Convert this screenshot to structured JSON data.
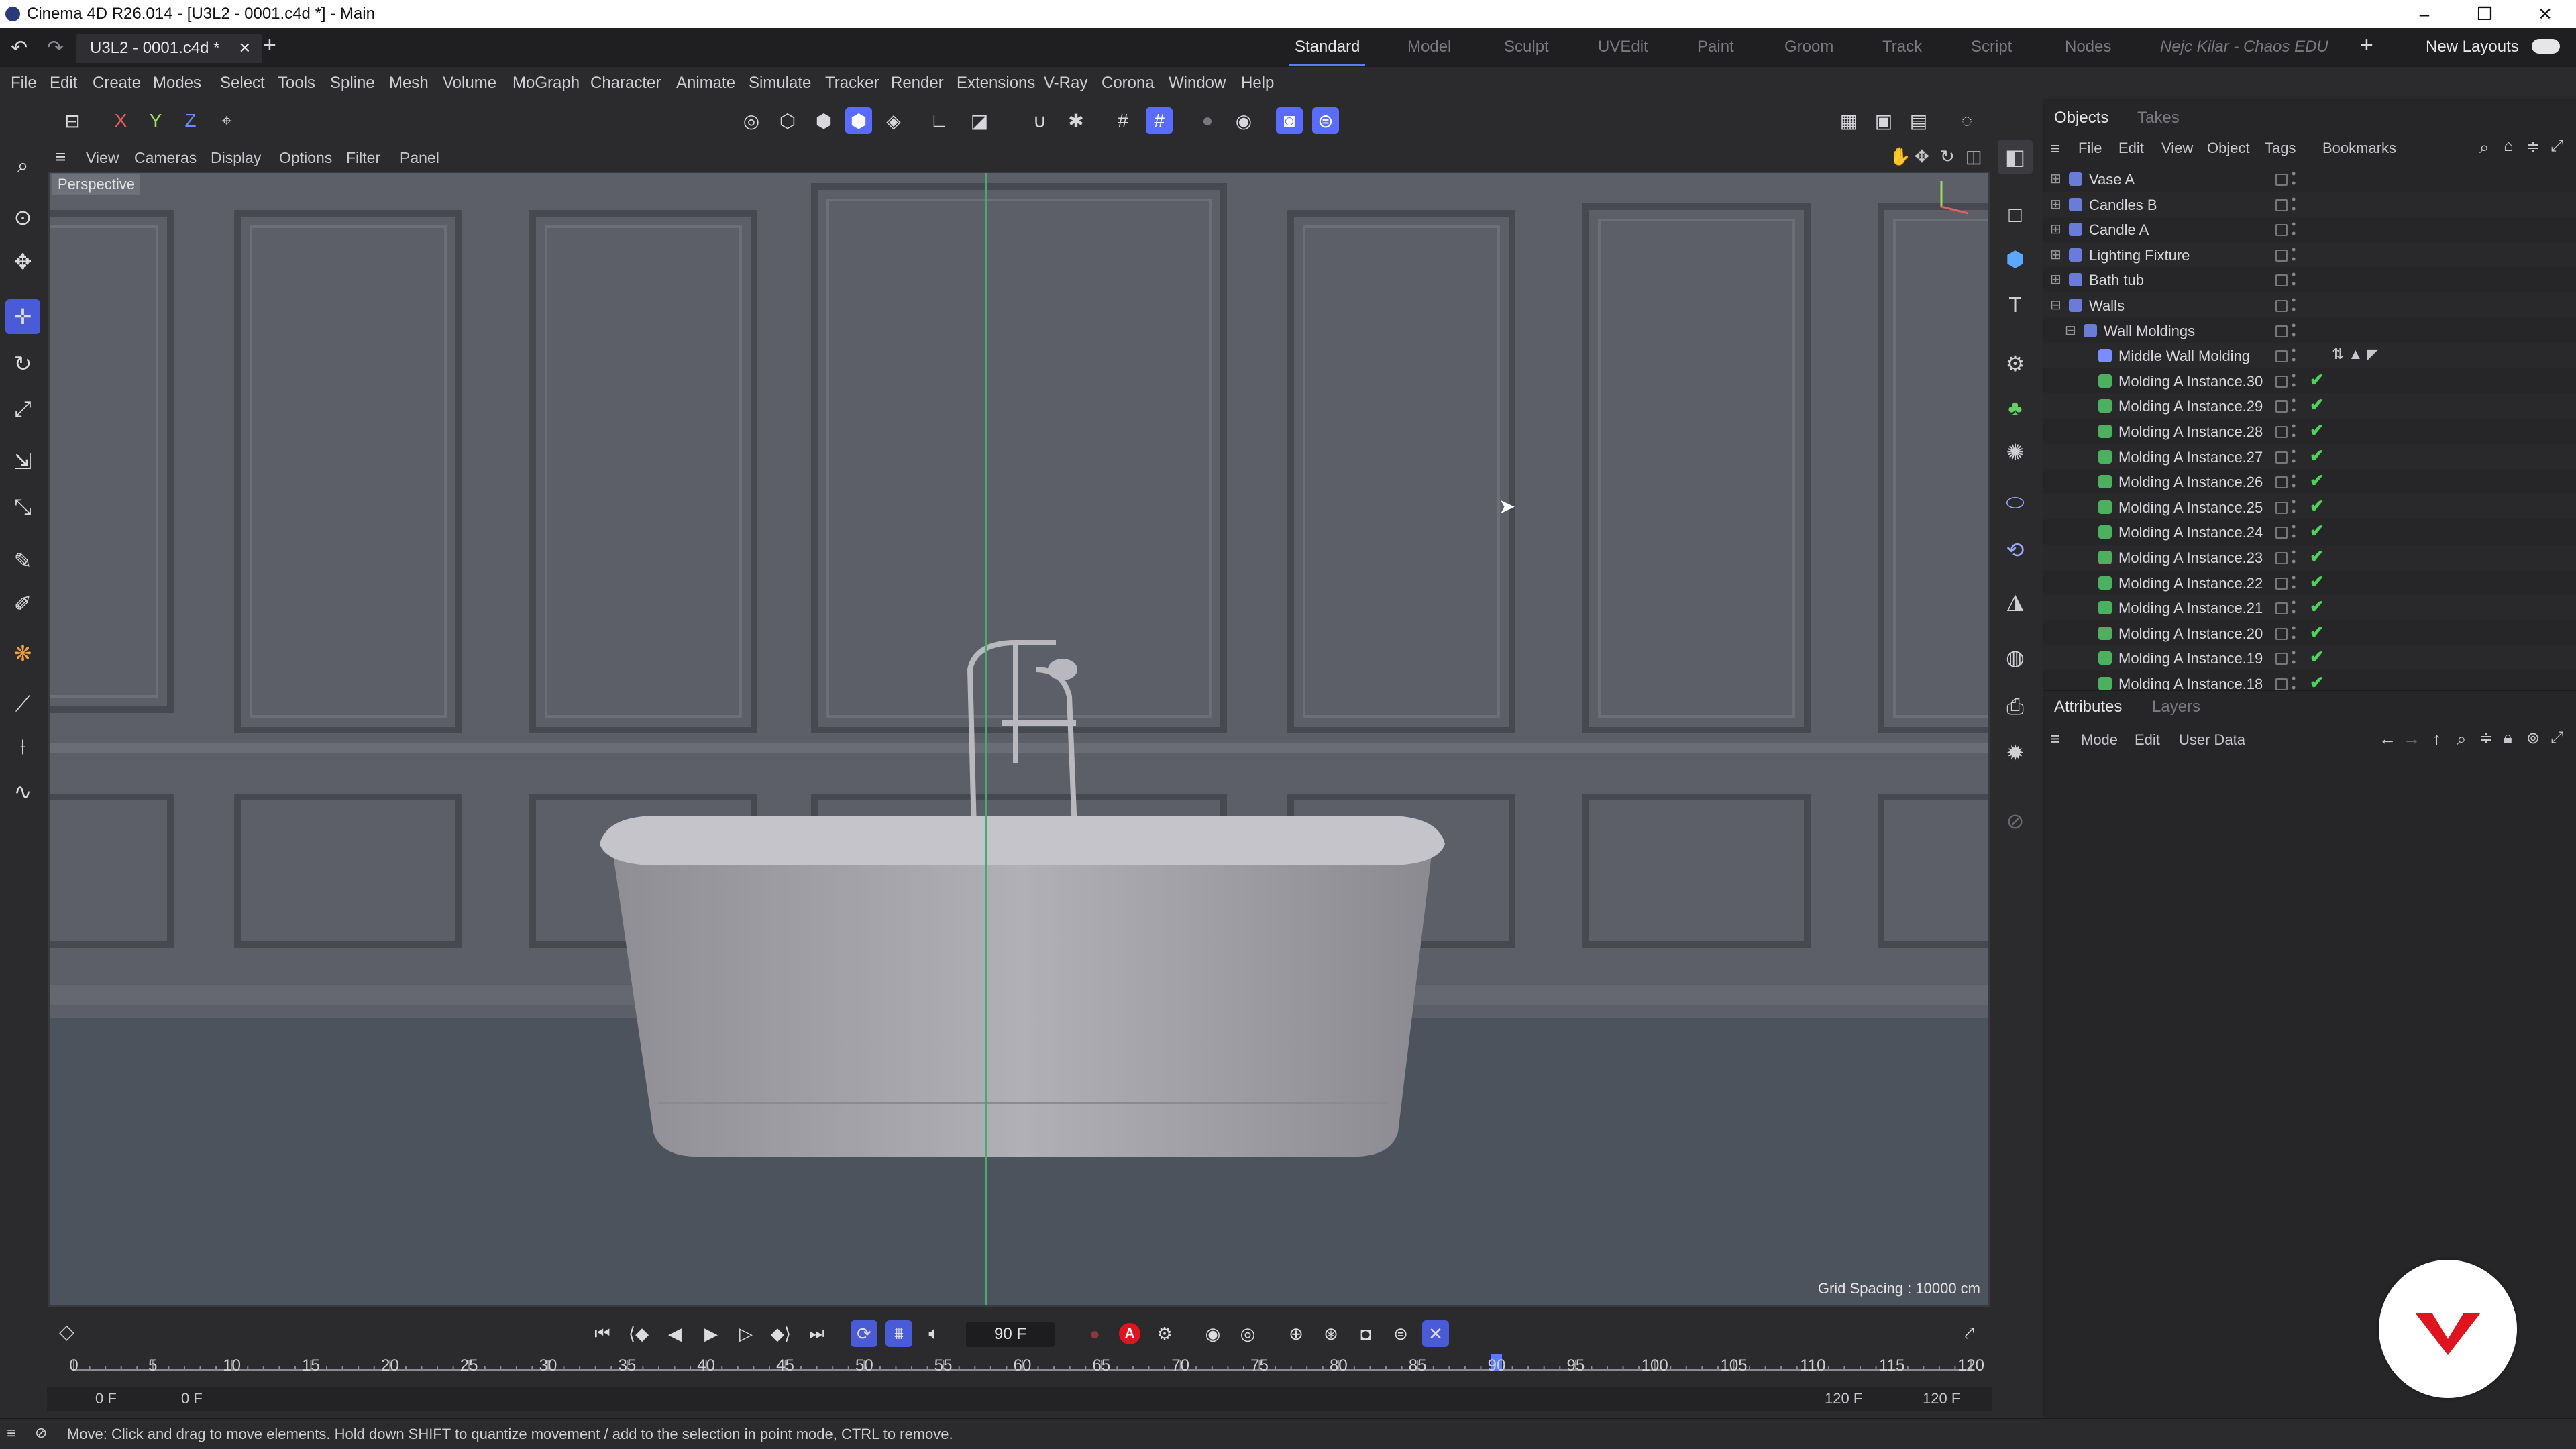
{
  "window": {
    "title": "Cinema 4D R26.014 - [U3L2 - 0001.c4d *] - Main",
    "minimize": "–",
    "maximize": "❐",
    "close": "✕"
  },
  "tabs": {
    "doc_tab": "U3L2 - 0001.c4d *",
    "doc_close": "✕",
    "add": "+",
    "layouts": [
      "Standard",
      "Model",
      "Sculpt",
      "UVEdit",
      "Paint",
      "Groom",
      "Track",
      "Script",
      "Nodes"
    ],
    "user": "Nejc Kilar - Chaos EDU",
    "new_layouts": "New Layouts"
  },
  "menu": [
    "File",
    "Edit",
    "Create",
    "Modes",
    "Select",
    "Tools",
    "Spline",
    "Mesh",
    "Volume",
    "MoGraph",
    "Character",
    "Animate",
    "Simulate",
    "Tracker",
    "Render",
    "Extensions",
    "V-Ray",
    "Corona",
    "Window",
    "Help"
  ],
  "axis_toolbar": {
    "x": "X",
    "y": "Y",
    "z": "Z"
  },
  "viewport": {
    "menus": [
      "View",
      "Cameras",
      "Display",
      "Options",
      "Filter",
      "Panel"
    ],
    "camera_label": "Perspective",
    "grid_spacing": "Grid Spacing : 10000 cm"
  },
  "objects_panel": {
    "tabs": [
      "Objects",
      "Takes"
    ],
    "menus": [
      "File",
      "Edit",
      "View",
      "Object",
      "Tags",
      "Bookmarks"
    ],
    "rows": [
      {
        "name": "Vase A",
        "indent": 0,
        "checked": false
      },
      {
        "name": "Candles B",
        "indent": 0,
        "checked": false
      },
      {
        "name": "Candle A",
        "indent": 0,
        "checked": false
      },
      {
        "name": "Lighting Fixture",
        "indent": 0,
        "checked": false
      },
      {
        "name": "Bath tub",
        "indent": 0,
        "checked": false
      },
      {
        "name": "Walls",
        "indent": 0,
        "checked": false
      },
      {
        "name": "Wall Moldings",
        "indent": 1,
        "checked": false
      },
      {
        "name": "Middle Wall Molding",
        "indent": 2,
        "checked": false
      },
      {
        "name": "Molding A Instance.30",
        "indent": 2,
        "checked": true
      },
      {
        "name": "Molding A Instance.29",
        "indent": 2,
        "checked": true
      },
      {
        "name": "Molding A Instance.28",
        "indent": 2,
        "checked": true
      },
      {
        "name": "Molding A Instance.27",
        "indent": 2,
        "checked": true
      },
      {
        "name": "Molding A Instance.26",
        "indent": 2,
        "checked": true
      },
      {
        "name": "Molding A Instance.25",
        "indent": 2,
        "checked": true
      },
      {
        "name": "Molding A Instance.24",
        "indent": 2,
        "checked": true
      },
      {
        "name": "Molding A Instance.23",
        "indent": 2,
        "checked": true
      },
      {
        "name": "Molding A Instance.22",
        "indent": 2,
        "checked": true
      },
      {
        "name": "Molding A Instance.21",
        "indent": 2,
        "checked": true
      },
      {
        "name": "Molding A Instance.20",
        "indent": 2,
        "checked": true
      },
      {
        "name": "Molding A Instance.19",
        "indent": 2,
        "checked": true
      },
      {
        "name": "Molding A Instance.18",
        "indent": 2,
        "checked": true
      }
    ]
  },
  "attributes_panel": {
    "tabs": [
      "Attributes",
      "Layers"
    ],
    "menus": [
      "Mode",
      "Edit",
      "User Data"
    ]
  },
  "timeline": {
    "current_frame": "90 F",
    "ruler": [
      "0",
      "5",
      "10",
      "15",
      "20",
      "25",
      "30",
      "35",
      "40",
      "45",
      "50",
      "55",
      "60",
      "65",
      "70",
      "75",
      "80",
      "85",
      "90",
      "95",
      "100",
      "105",
      "110",
      "115",
      "120"
    ],
    "start_a": "0 F",
    "start_b": "0 F",
    "end_a": "120 F",
    "end_b": "120 F",
    "playhead": 90
  },
  "status": {
    "text": "Move: Click and drag to move elements. Hold down SHIFT to quantize movement / add to the selection in point mode, CTRL to remove."
  },
  "colors": {
    "accent": "#5a7bff",
    "check": "#4cd45a",
    "logo": "#e0141e"
  }
}
